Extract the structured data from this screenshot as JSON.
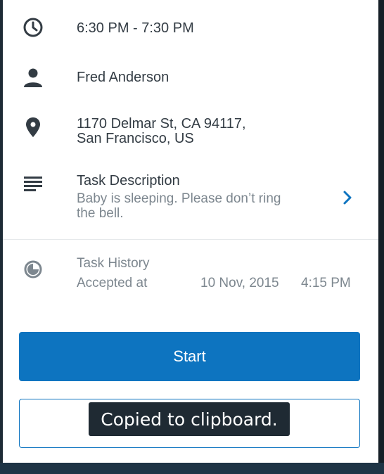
{
  "time": {
    "icon": "clock-icon",
    "value": "6:30 PM - 7:30 PM"
  },
  "customer": {
    "icon": "person-icon",
    "name": "Fred Anderson"
  },
  "address": {
    "icon": "location-pin-icon",
    "line1": "1170 Delmar St, CA 94117,",
    "line2": "San Francisco, US"
  },
  "task": {
    "icon": "notes-icon",
    "title": "Task Description",
    "line1": "Baby is sleeping. Please don’t ring",
    "line2": "the bell.",
    "chevron": "chevron-right-icon"
  },
  "history": {
    "icon": "history-icon",
    "title": "Task History",
    "label": "Accepted at",
    "date": "10 Nov, 2015",
    "time": "4:15 PM"
  },
  "actions": {
    "start_label": "Start",
    "secondary_label": ""
  },
  "toast": {
    "message": "Copied to clipboard."
  },
  "colors": {
    "accent": "#0d74c0",
    "text": "#333c44",
    "muted": "#7d878f",
    "toast_bg": "#1f2a33"
  }
}
